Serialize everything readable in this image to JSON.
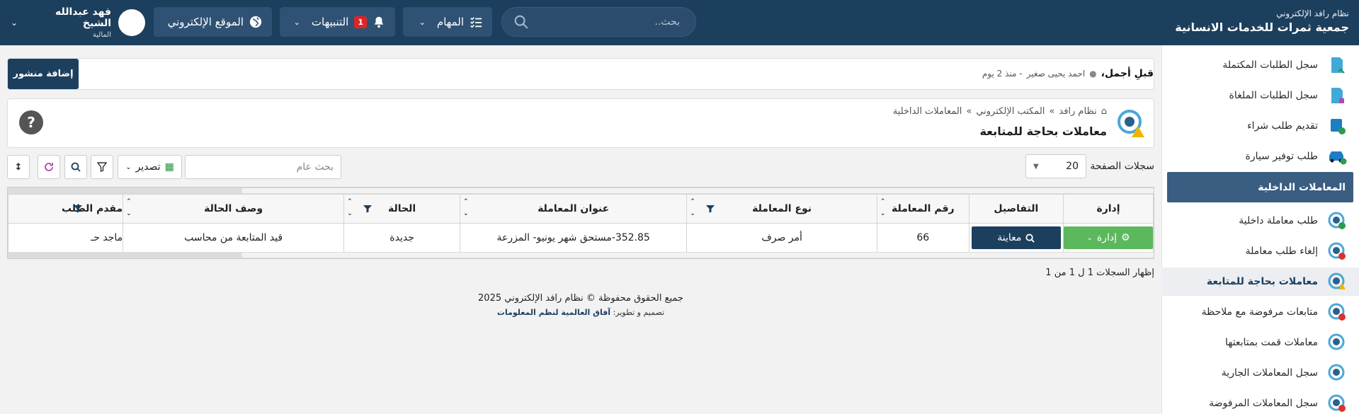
{
  "topbar": {
    "org_sub": "نظام رافد الإلكتروني",
    "org_title": "جمعية ثمرات للخدمات الانسانية",
    "search_placeholder": "بحث..",
    "tasks_label": "المهام",
    "notifications_label": "التنبيهات",
    "notifications_count": "1",
    "website_label": "الموقع الإلكتروني",
    "user_name": "فهد عبدالله الشيخ",
    "user_role": "المالية"
  },
  "sidebar": {
    "items_top": [
      {
        "label": "سجل الطلبات المكتملة",
        "icon": "completed-requests-icon"
      },
      {
        "label": "سجل الطلبات الملغاة",
        "icon": "cancelled-requests-icon"
      },
      {
        "label": "تقديم طلب شراء",
        "icon": "purchase-request-icon"
      },
      {
        "label": "طلب توفير سيارة",
        "icon": "car-request-icon"
      }
    ],
    "section_title": "المعاملات الداخلية",
    "items_bottom": [
      {
        "label": "طلب معاملة داخلية",
        "icon": "gear-add-icon"
      },
      {
        "label": "إلغاء طلب معاملة",
        "icon": "gear-cancel-icon"
      },
      {
        "label": "معاملات بحاجة للمتابعة",
        "icon": "gear-warning-icon"
      },
      {
        "label": "متابعات مرفوضة مع ملاحظة",
        "icon": "gear-alert-icon"
      },
      {
        "label": "معاملات قمت بمتابعتها",
        "icon": "gear-check-icon"
      },
      {
        "label": "سجل المعاملات الجارية",
        "icon": "gear-icon"
      },
      {
        "label": "سجل المعاملات المرفوضة",
        "icon": "gear-reject-icon"
      }
    ]
  },
  "post_bar": {
    "ticker_title": "قبلِ أجمل،",
    "ticker_author": "احمد يحيى صغير",
    "ticker_time": "- منذ 2 يوم",
    "add_post": "إضافة منشور"
  },
  "header": {
    "crumb_home": "نظام رافد",
    "crumb_2": "المكتب الإلكتروني",
    "crumb_3": "المعاملات الداخلية",
    "title": "معاملات بحاجة للمتابعة",
    "help": "?"
  },
  "toolbar": {
    "per_page_label": "سجلات الصفحة",
    "per_page_value": "20",
    "search_placeholder": "بحث عام",
    "export_label": "تصدير"
  },
  "table": {
    "headers": [
      "إدارة",
      "التفاصيل",
      "رقم المعاملة",
      "نوع المعاملة",
      "عنوان المعاملة",
      "الحالة",
      "وصف الحالة",
      "مقدم الطلب"
    ],
    "manage_btn": "إدارة",
    "preview_btn": "معاينة",
    "rows": [
      {
        "number": "66",
        "type": "أمر صرف",
        "title": "352.85-مستحق شهر يونيو- المزرعة",
        "status": "جديدة",
        "status_desc": "قيد المتابعة من محاسب",
        "requester": "ماجد حـ"
      }
    ]
  },
  "showing_text": "إظهار السجلات 1 ل 1 من 1",
  "footer": {
    "copyright": "جميع الحقوق محفوظة © نظام رافد الإلكتروني 2025",
    "dev_prefix": "تصميم و تطوير:",
    "dev_name": "آفاق العالمية لنظم المعلومات"
  }
}
